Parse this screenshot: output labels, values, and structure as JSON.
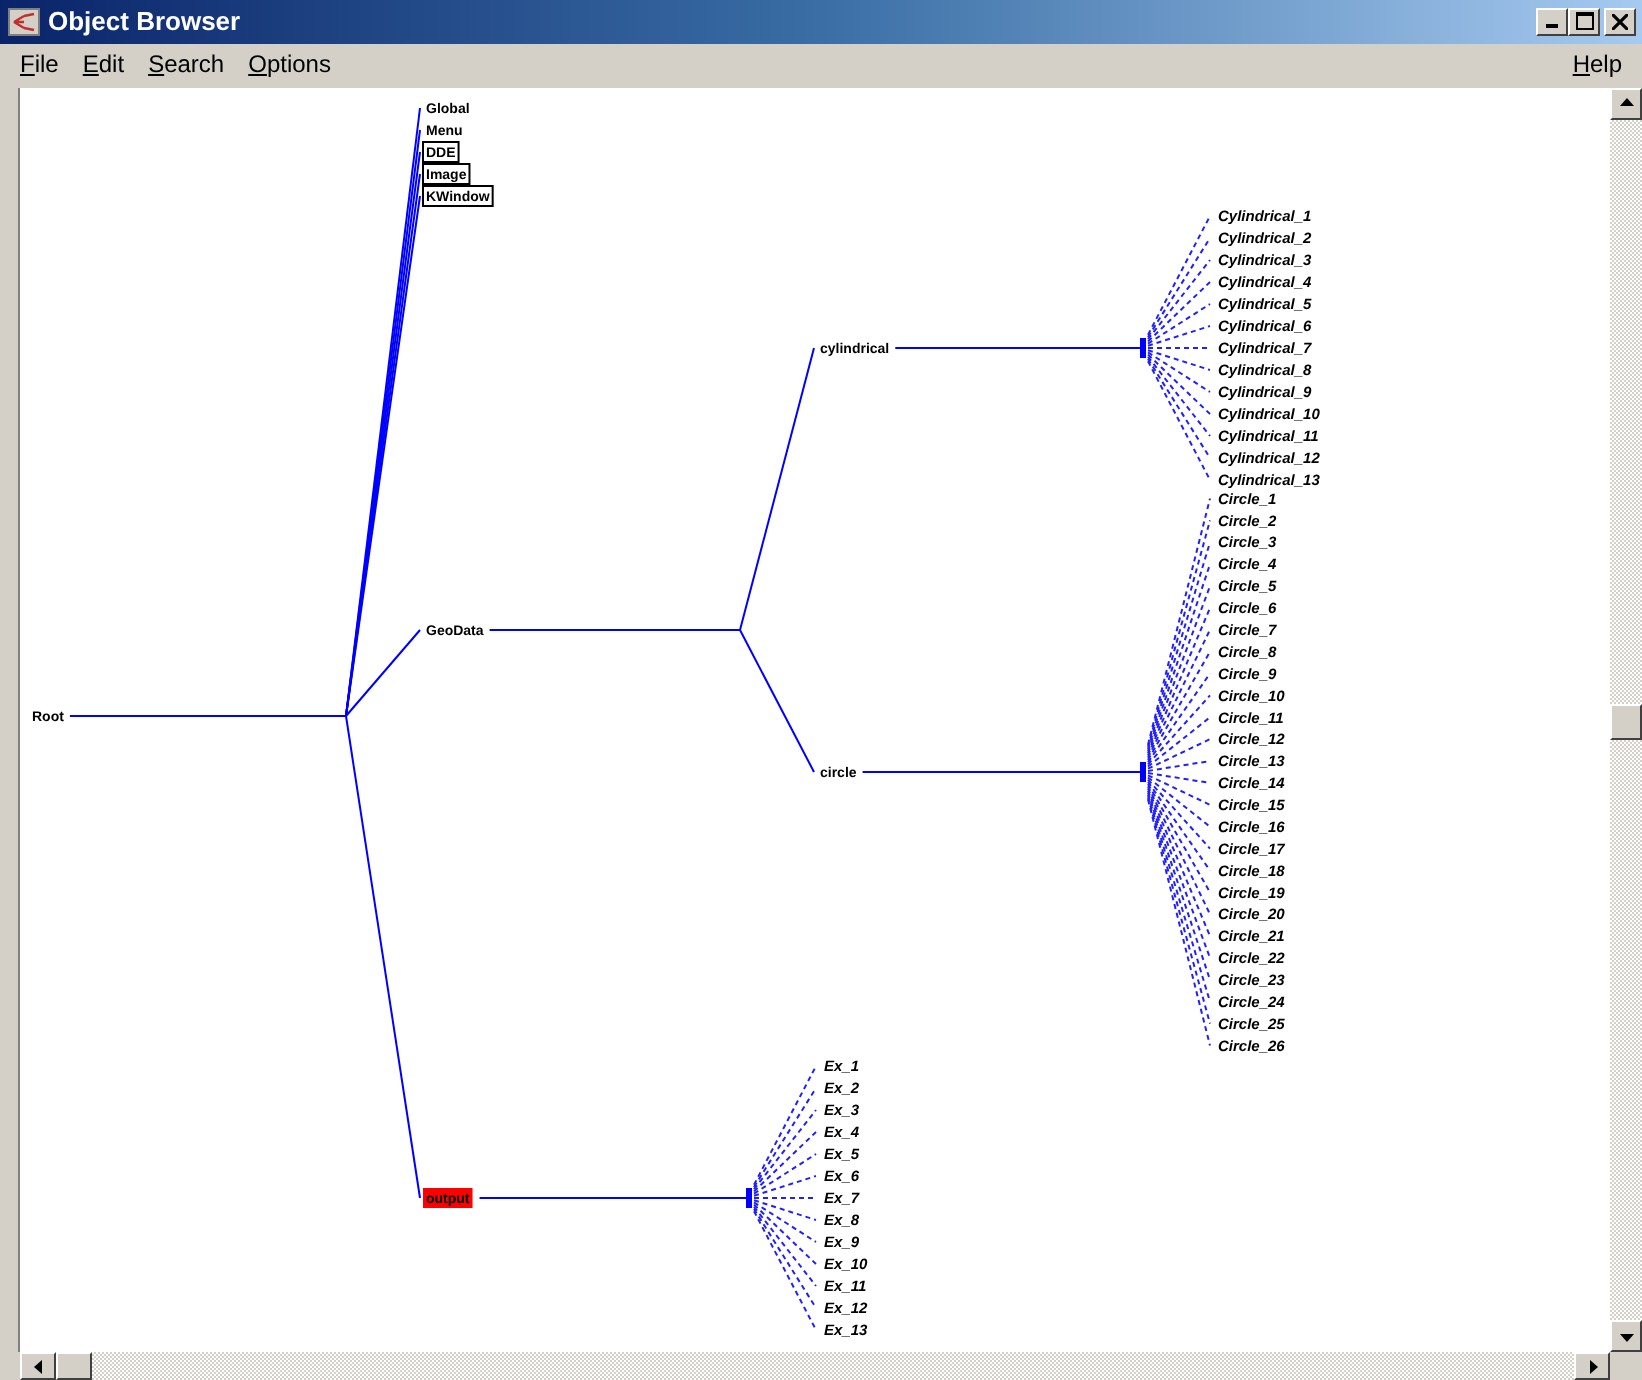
{
  "window": {
    "title": "Object Browser"
  },
  "menu": [
    {
      "label": "File"
    },
    {
      "label": "Edit"
    },
    {
      "label": "Search"
    },
    {
      "label": "Options"
    }
  ],
  "help_menu": {
    "label": "Help"
  },
  "tree": {
    "label": "Root",
    "boxed": false,
    "selected": false,
    "children": [
      {
        "label": "Global",
        "boxed": false,
        "selected": false
      },
      {
        "label": "Menu",
        "boxed": false,
        "selected": false
      },
      {
        "label": "DDE",
        "boxed": true,
        "selected": false
      },
      {
        "label": "Image",
        "boxed": true,
        "selected": false
      },
      {
        "label": "KWindow",
        "boxed": true,
        "selected": false
      },
      {
        "label": "GeoData",
        "boxed": false,
        "selected": false,
        "children": [
          {
            "label": "cylindrical",
            "boxed": false,
            "selected": false,
            "children": [
              {
                "label": "Cylindrical_1",
                "boxed": false,
                "selected": false
              },
              {
                "label": "Cylindrical_2",
                "boxed": false,
                "selected": false
              },
              {
                "label": "Cylindrical_3",
                "boxed": false,
                "selected": false
              },
              {
                "label": "Cylindrical_4",
                "boxed": false,
                "selected": false
              },
              {
                "label": "Cylindrical_5",
                "boxed": false,
                "selected": false
              },
              {
                "label": "Cylindrical_6",
                "boxed": false,
                "selected": false
              },
              {
                "label": "Cylindrical_7",
                "boxed": false,
                "selected": false
              },
              {
                "label": "Cylindrical_8",
                "boxed": false,
                "selected": false
              },
              {
                "label": "Cylindrical_9",
                "boxed": false,
                "selected": false
              },
              {
                "label": "Cylindrical_10",
                "boxed": false,
                "selected": false
              },
              {
                "label": "Cylindrical_11",
                "boxed": false,
                "selected": false
              },
              {
                "label": "Cylindrical_12",
                "boxed": false,
                "selected": false
              },
              {
                "label": "Cylindrical_13",
                "boxed": false,
                "selected": false
              }
            ]
          },
          {
            "label": "circle",
            "boxed": false,
            "selected": false,
            "children": [
              {
                "label": "Circle_1",
                "boxed": false,
                "selected": false
              },
              {
                "label": "Circle_2",
                "boxed": false,
                "selected": false
              },
              {
                "label": "Circle_3",
                "boxed": false,
                "selected": false
              },
              {
                "label": "Circle_4",
                "boxed": false,
                "selected": false
              },
              {
                "label": "Circle_5",
                "boxed": false,
                "selected": false
              },
              {
                "label": "Circle_6",
                "boxed": false,
                "selected": false
              },
              {
                "label": "Circle_7",
                "boxed": false,
                "selected": false
              },
              {
                "label": "Circle_8",
                "boxed": false,
                "selected": false
              },
              {
                "label": "Circle_9",
                "boxed": false,
                "selected": false
              },
              {
                "label": "Circle_10",
                "boxed": false,
                "selected": false
              },
              {
                "label": "Circle_11",
                "boxed": false,
                "selected": false
              },
              {
                "label": "Circle_12",
                "boxed": false,
                "selected": false
              },
              {
                "label": "Circle_13",
                "boxed": false,
                "selected": false
              },
              {
                "label": "Circle_14",
                "boxed": false,
                "selected": false
              },
              {
                "label": "Circle_15",
                "boxed": false,
                "selected": false
              },
              {
                "label": "Circle_16",
                "boxed": false,
                "selected": false
              },
              {
                "label": "Circle_17",
                "boxed": false,
                "selected": false
              },
              {
                "label": "Circle_18",
                "boxed": false,
                "selected": false
              },
              {
                "label": "Circle_19",
                "boxed": false,
                "selected": false
              },
              {
                "label": "Circle_20",
                "boxed": false,
                "selected": false
              },
              {
                "label": "Circle_21",
                "boxed": false,
                "selected": false
              },
              {
                "label": "Circle_22",
                "boxed": false,
                "selected": false
              },
              {
                "label": "Circle_23",
                "boxed": false,
                "selected": false
              },
              {
                "label": "Circle_24",
                "boxed": false,
                "selected": false
              },
              {
                "label": "Circle_25",
                "boxed": false,
                "selected": false
              },
              {
                "label": "Circle_26",
                "boxed": false,
                "selected": false
              }
            ]
          }
        ]
      },
      {
        "label": "output",
        "boxed": false,
        "selected": true,
        "children": [
          {
            "label": "Ex_1",
            "boxed": false,
            "selected": false
          },
          {
            "label": "Ex_2",
            "boxed": false,
            "selected": false
          },
          {
            "label": "Ex_3",
            "boxed": false,
            "selected": false
          },
          {
            "label": "Ex_4",
            "boxed": false,
            "selected": false
          },
          {
            "label": "Ex_5",
            "boxed": false,
            "selected": false
          },
          {
            "label": "Ex_6",
            "boxed": false,
            "selected": false
          },
          {
            "label": "Ex_7",
            "boxed": false,
            "selected": false
          },
          {
            "label": "Ex_8",
            "boxed": false,
            "selected": false
          },
          {
            "label": "Ex_9",
            "boxed": false,
            "selected": false
          },
          {
            "label": "Ex_10",
            "boxed": false,
            "selected": false
          },
          {
            "label": "Ex_11",
            "boxed": false,
            "selected": false
          },
          {
            "label": "Ex_12",
            "boxed": false,
            "selected": false
          },
          {
            "label": "Ex_13",
            "boxed": false,
            "selected": false
          }
        ]
      }
    ]
  }
}
